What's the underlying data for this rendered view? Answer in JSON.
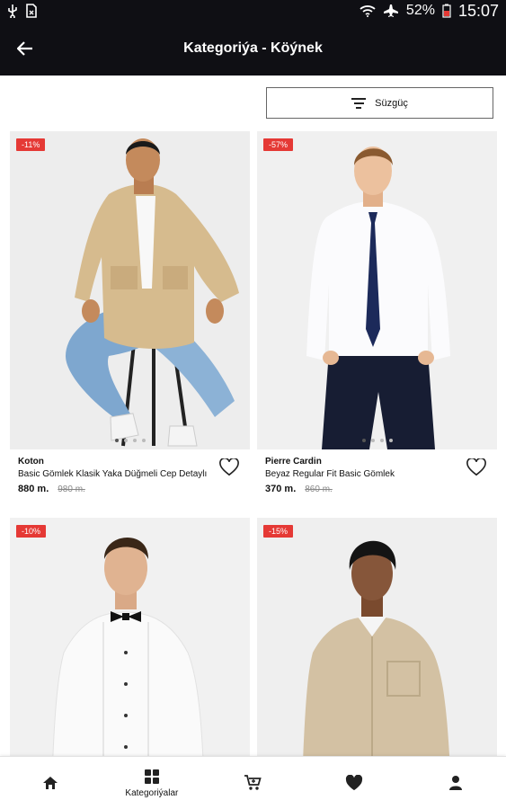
{
  "status_bar": {
    "battery": "52%",
    "time": "15:07",
    "icons": [
      "usb-icon",
      "no-sim-icon",
      "wifi-icon",
      "airplane-icon",
      "battery-icon"
    ]
  },
  "appbar": {
    "title": "Kategoriýa - Köýnek",
    "back_icon": "arrow-left-icon"
  },
  "filter": {
    "label": "Süzgüç",
    "icon": "filter-lines-icon"
  },
  "products": [
    {
      "badge": "-11%",
      "brand": "Koton",
      "name": "Basic Gömlek Klasik Yaka Düğmeli Cep Detaylı",
      "price": "880 m.",
      "old_price": "980 m.",
      "image": "man-sitting-beige-overshirt-jeans",
      "carousel_dots": 4,
      "active_dot": 0
    },
    {
      "badge": "-57%",
      "brand": "Pierre Cardin",
      "name": "Beyaz Regular Fit Basic Gömlek",
      "price": "370 m.",
      "old_price": "860 m.",
      "image": "man-white-shirt-navy-tie",
      "carousel_dots": 4,
      "active_dot": 0
    },
    {
      "badge": "-10%",
      "brand": "",
      "name": "",
      "price": "",
      "old_price": "",
      "image": "man-white-tuxedo-shirt-bowtie",
      "carousel_dots": 0,
      "active_dot": 0
    },
    {
      "badge": "-15%",
      "brand": "",
      "name": "",
      "price": "",
      "old_price": "",
      "image": "man-beige-overshirt",
      "carousel_dots": 0,
      "active_dot": 0
    }
  ],
  "bottom_nav": {
    "items": [
      {
        "icon": "home-icon",
        "label": ""
      },
      {
        "icon": "grid-icon",
        "label": "Kategoriýalar"
      },
      {
        "icon": "cart-icon",
        "label": ""
      },
      {
        "icon": "heart-icon",
        "label": ""
      },
      {
        "icon": "user-icon",
        "label": ""
      }
    ]
  },
  "colors": {
    "bar": "#0f0f14",
    "badge": "#e53935",
    "background": "#ffffff"
  }
}
